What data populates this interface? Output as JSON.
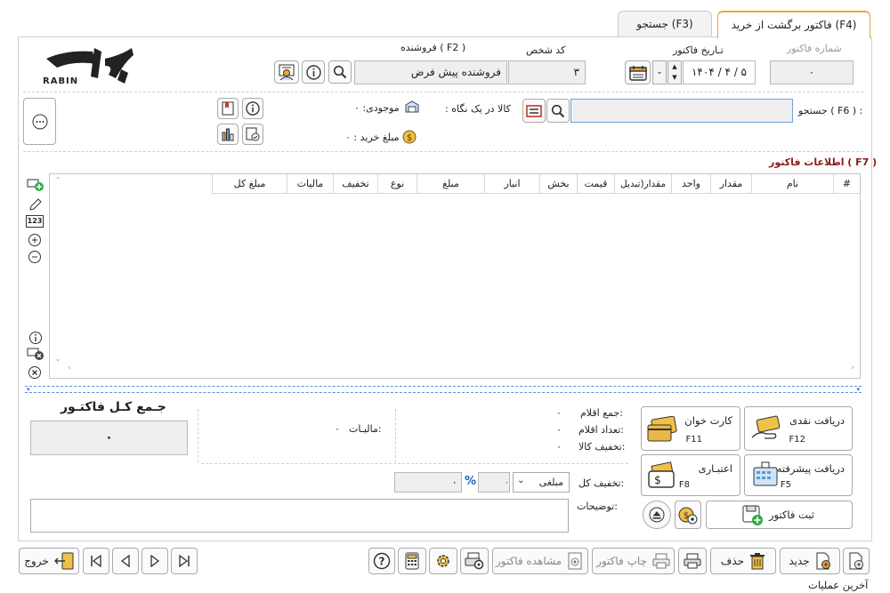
{
  "tabs": [
    {
      "label": "فاکتور برگشت از خرید (F4)"
    },
    {
      "label": "جستجو (F3)"
    }
  ],
  "header": {
    "invoice_number_label": "شماره فاکتور",
    "invoice_number_value": "۰",
    "invoice_date_label": "تـاریخ فاکتور",
    "invoice_date_value": "۱۴۰۴ / ۴ / ۵",
    "person_code_label": "کد شخص",
    "person_code_value": "۳",
    "seller_label": "فروشنده ( F2 )",
    "seller_value": "فروشنده پیش فرض",
    "logo_text": "RABIN"
  },
  "search": {
    "label": "جستجو ( F6 ) :",
    "value": "",
    "item_at_glance": ": کالا در یک نگاه",
    "stock": "موجودی: ۰",
    "purchase_amount": "مبلغ خرید : ۰"
  },
  "invoice_info": {
    "title": "اطلاعات فاکتور ( F7 )",
    "columns": [
      "#",
      "نام",
      "مقدار",
      "واحد",
      "مقدار(تبدیل",
      "قیمت",
      "بخش",
      "انبار",
      "مبلغ",
      "نوع",
      "تخفیف",
      "مالیات",
      "مبلغ کل"
    ]
  },
  "summary": {
    "total_items_label": "جمع اقلام:",
    "total_items_value": "۰",
    "items_count_label": "تعداد اقلام:",
    "items_count_value": "۰",
    "goods_discount_label": "تخفیف کالا:",
    "goods_discount_value": "۰",
    "tax_label": "مالیـات:",
    "tax_value": "۰",
    "grand_total_label": "جـمع کـل فاکتـور",
    "grand_total_value": "۰",
    "total_discount_label": "تخفیف کل:",
    "discount_type": "مبلغی",
    "discount_percent": "۰",
    "discount_amount": "۰",
    "percent_sign": "%",
    "notes_label": "توضیحات:"
  },
  "payments": {
    "cash": {
      "label": "دریافت نقدی",
      "key": "F12"
    },
    "card": {
      "label": "کارت خوان",
      "key": "F11"
    },
    "advanced": {
      "label": "دریافت پیشرفته",
      "key": "F5"
    },
    "credit": {
      "label": "اعتبـاری",
      "key": "F8"
    },
    "save": {
      "label": "ثبت فاکتور"
    }
  },
  "bottom": {
    "new": "جدید",
    "delete": "حذف",
    "print": "چاپ فاکتور",
    "view": "مشاهده فاکتور",
    "exit": "خروج",
    "status": "آخرین عملیات"
  },
  "colors": {
    "accent": "#e8a23c",
    "title": "#8b1a1a",
    "blue": "#1a5fbf"
  }
}
